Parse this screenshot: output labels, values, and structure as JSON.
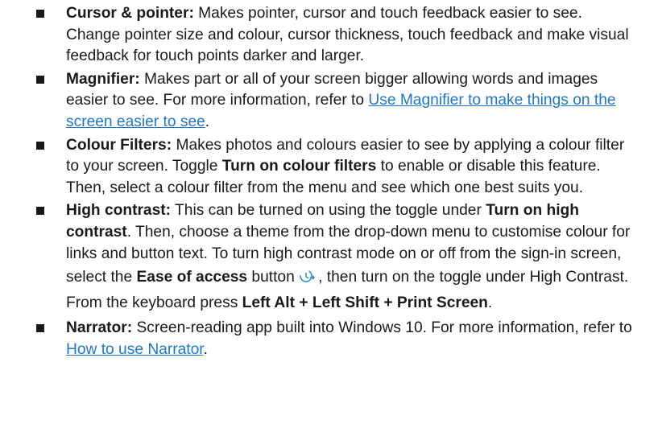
{
  "items": [
    {
      "title": "Cursor & pointer:",
      "text": " Makes pointer, cursor and touch feedback easier to see. Change pointer size and colour, cursor thickness, touch feedback and make visual feedback for touch points darker and larger."
    },
    {
      "title": "Magnifier:",
      "text": " Makes part or all of your screen bigger allowing words and images easier to see. For more information, refer to ",
      "link": "Use Magnifier to make things on the screen easier to see",
      "after": "."
    },
    {
      "title": "Colour Filters:",
      "text": " Makes photos and colours easier to see by applying a colour filter to your screen. Toggle ",
      "bold": "Turn on colour filters",
      "text2": " to enable or disable this feature. Then, select a colour filter from the menu and see which one best suits you."
    },
    {
      "title": "High contrast:",
      "text": " This can be turned on using the toggle under ",
      "bold": "Turn on high contrast",
      "text2": ". Then, choose a theme from the drop-down menu to customise colour for links and button text. To turn high contrast mode on or off from the sign-in screen, select the ",
      "bold2": "Ease of access",
      "text3": " button",
      "icon": "ease-of-access-icon",
      "text4": ", then turn on the toggle under High Contrast. From the keyboard press ",
      "bold3": "Left Alt + Left Shift + Print Screen",
      "after": "."
    },
    {
      "title": "Narrator:",
      "text": " Screen-reading app built into Windows 10. For more information, refer to ",
      "link": "How to use Narrator",
      "after": "."
    }
  ],
  "colors": {
    "text": "#1a1a1a",
    "link": "#1e77c8",
    "icon": "#2f8fd8"
  }
}
